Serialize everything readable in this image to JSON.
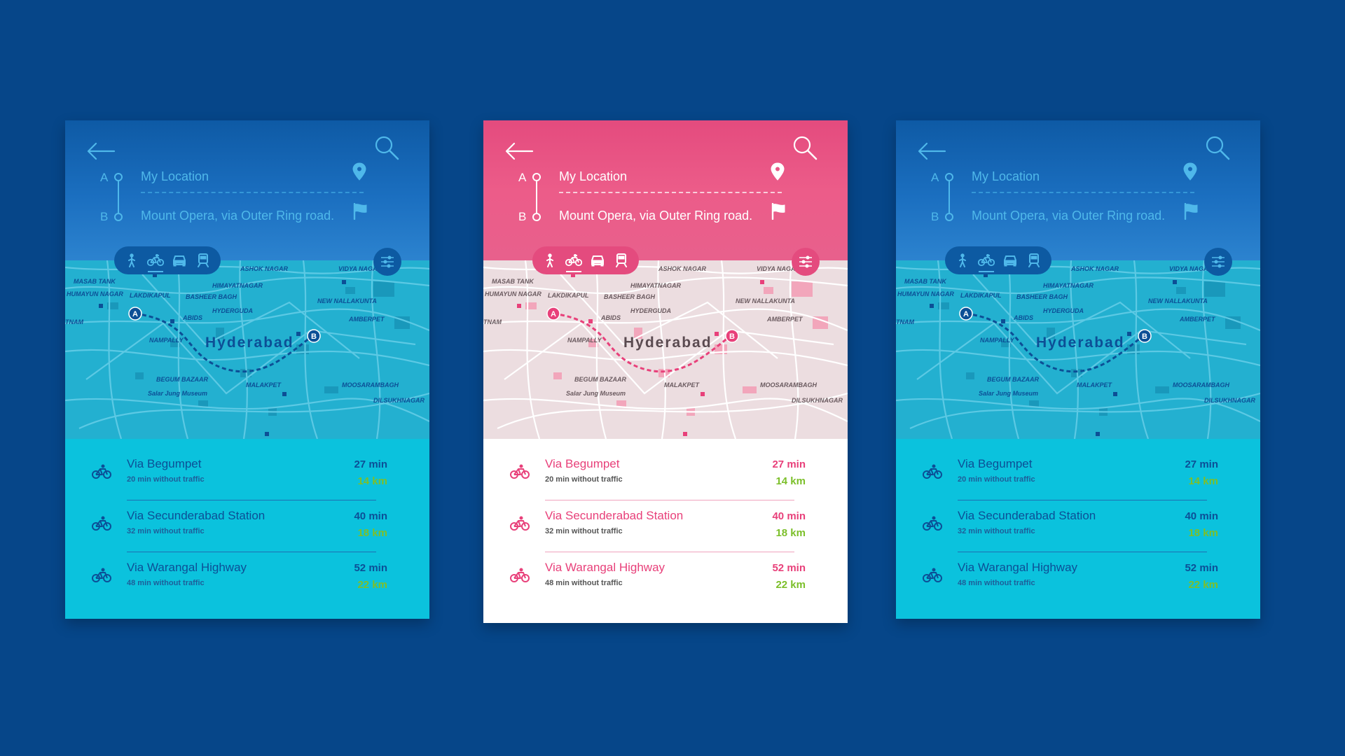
{
  "colors": {
    "background": "#064689",
    "blue_text": "#0c4f96",
    "blue_header_text": "#4fb8ea",
    "pink_accent": "#e8407a",
    "green_distance": "#7cbf2a"
  },
  "cards": [
    {
      "theme": "blue",
      "header": {
        "point_a": "A",
        "point_b": "B",
        "origin": "My Location",
        "destination": "Mount Opera, via Outer Ring road."
      },
      "map": {
        "city": "Hyderabad",
        "marker_a": "A",
        "marker_b": "B",
        "labels": [
          "MASAB TANK",
          "ASHOK NAGAR",
          "VIDYA NAGAR",
          "HIMAYATNAGAR",
          "HUMAYUN NAGAR",
          "LAKDIKAPUL",
          "BASHEER BAGH",
          "NEW NALLAKUNTA",
          "ABIDS",
          "HYDERGUDA",
          "TNAM",
          "AMBERPET",
          "NAMPALLY",
          "BEGUM BAZAAR",
          "MALAKPET",
          "MOOSARAMBAGH",
          "Salar Jung Museum",
          "DILSUKHNAGAR"
        ]
      },
      "routes": [
        {
          "name": "Via Begumpet",
          "sub": "20 min without traffic",
          "time": "27 min",
          "dist": "14 km"
        },
        {
          "name": "Via Secunderabad Station",
          "sub": "32 min without traffic",
          "time": "40 min",
          "dist": "18 km"
        },
        {
          "name": "Via Warangal Highway",
          "sub": "48 min without traffic",
          "time": "52 min",
          "dist": "22 km"
        }
      ]
    },
    {
      "theme": "pink",
      "header": {
        "point_a": "A",
        "point_b": "B",
        "origin": "My Location",
        "destination": "Mount Opera, via Outer Ring road."
      },
      "map": {
        "city": "Hyderabad",
        "marker_a": "A",
        "marker_b": "B",
        "labels": [
          "MASAB TANK",
          "ASHOK NAGAR",
          "VIDYA NAGAR",
          "HIMAYATNAGAR",
          "HUMAYUN NAGAR",
          "LAKDIKAPUL",
          "BASHEER BAGH",
          "NEW NALLAKUNTA",
          "ABIDS",
          "HYDERGUDA",
          "TNAM",
          "AMBERPET",
          "NAMPALLY",
          "BEGUM BAZAAR",
          "MALAKPET",
          "MOOSARAMBAGH",
          "Salar Jung Museum",
          "DILSUKHNAGAR"
        ]
      },
      "routes": [
        {
          "name": "Via Begumpet",
          "sub": "20 min without traffic",
          "time": "27 min",
          "dist": "14 km"
        },
        {
          "name": "Via Secunderabad Station",
          "sub": "32 min without traffic",
          "time": "40 min",
          "dist": "18 km"
        },
        {
          "name": "Via Warangal Highway",
          "sub": "48 min without traffic",
          "time": "52 min",
          "dist": "22 km"
        }
      ]
    },
    {
      "theme": "blue",
      "header": {
        "point_a": "A",
        "point_b": "B",
        "origin": "My Location",
        "destination": "Mount Opera, via Outer Ring road."
      },
      "map": {
        "city": "Hyderabad",
        "marker_a": "A",
        "marker_b": "B",
        "labels": [
          "MASAB TANK",
          "ASHOK NAGAR",
          "VIDYA NAGAR",
          "HIMAYATNAGAR",
          "HUMAYUN NAGAR",
          "LAKDIKAPUL",
          "BASHEER BAGH",
          "NEW NALLAKUNTA",
          "ABIDS",
          "HYDERGUDA",
          "TNAM",
          "AMBERPET",
          "NAMPALLY",
          "BEGUM BAZAAR",
          "MALAKPET",
          "MOOSARAMBAGH",
          "Salar Jung Museum",
          "DILSUKHNAGAR"
        ]
      },
      "routes": [
        {
          "name": "Via Begumpet",
          "sub": "20 min without traffic",
          "time": "27 min",
          "dist": "14 km"
        },
        {
          "name": "Via Secunderabad Station",
          "sub": "32 min without traffic",
          "time": "40 min",
          "dist": "18 km"
        },
        {
          "name": "Via Warangal Highway",
          "sub": "48 min without traffic",
          "time": "52 min",
          "dist": "22 km"
        }
      ]
    }
  ],
  "icons": {
    "back": "arrow-left-icon",
    "search": "search-icon",
    "pin": "location-pin-icon",
    "flag": "flag-icon",
    "walk": "walk-icon",
    "bike": "bike-icon",
    "car": "car-icon",
    "train": "train-icon",
    "filter": "filter-sliders-icon"
  }
}
